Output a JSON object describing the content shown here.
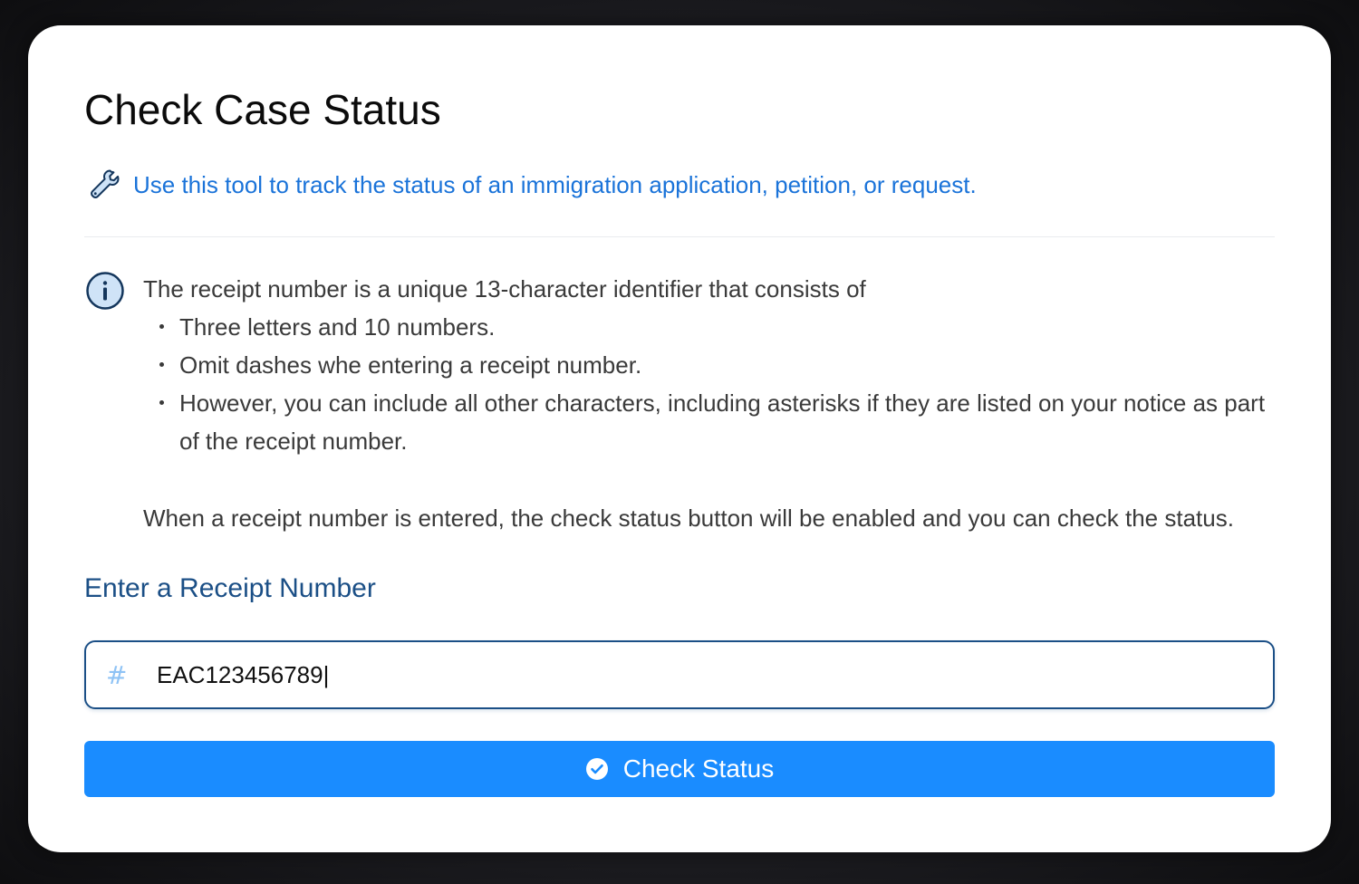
{
  "page": {
    "title": "Check Case Status",
    "intro": "Use this tool to track the status of an immigration application, petition, or request."
  },
  "info": {
    "lead": "The receipt number is a unique 13-character identifier that consists of",
    "bullets": [
      "Three letters and 10 numbers.",
      "Omit dashes whe entering a receipt number.",
      "However, you can include all other characters, including asterisks if they are listed on your notice as part of the receipt number."
    ],
    "note": "When a receipt number is entered, the check status button will be enabled and you can check the status."
  },
  "form": {
    "label": "Enter a Receipt Number",
    "prefix_icon": "#",
    "value": "EAC123456789|",
    "button_label": "Check Status"
  },
  "icons": {
    "intro": "wrench-icon",
    "info": "info-icon",
    "input_prefix": "hash-icon",
    "button": "check-circle-icon"
  },
  "colors": {
    "accent_blue": "#1a8cff",
    "link_blue": "#1a73d9",
    "label_navy": "#1b4f86"
  }
}
